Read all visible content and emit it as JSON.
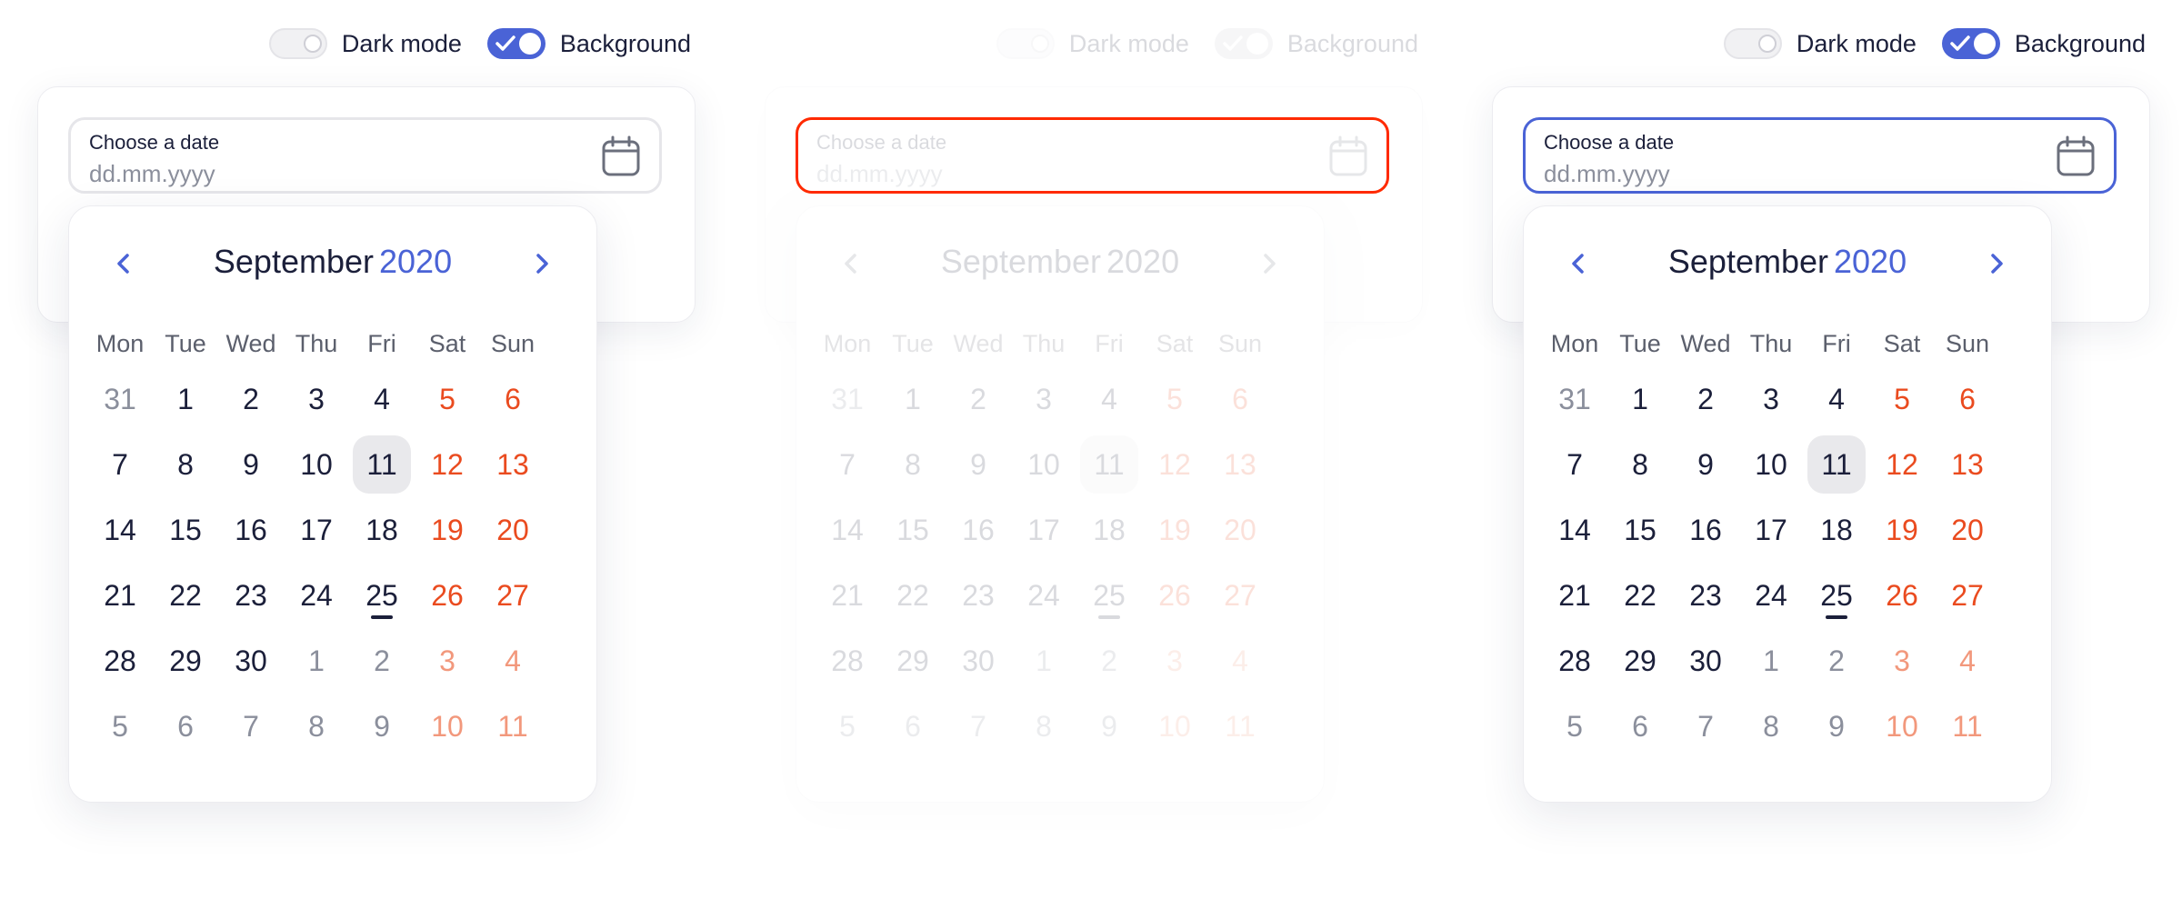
{
  "toggles": {
    "dark_mode_label": "Dark mode",
    "background_label": "Background"
  },
  "date_field": {
    "label": "Choose a date",
    "placeholder": "dd.mm.yyyy"
  },
  "calendar": {
    "month": "September",
    "year": "2020",
    "weekdays": [
      "Mon",
      "Tue",
      "Wed",
      "Thu",
      "Fri",
      "Sat",
      "Sun"
    ],
    "weeks": [
      [
        "31",
        "1",
        "2",
        "3",
        "4",
        "5",
        "6"
      ],
      [
        "7",
        "8",
        "9",
        "10",
        "11",
        "12",
        "13"
      ],
      [
        "14",
        "15",
        "16",
        "17",
        "18",
        "19",
        "20"
      ],
      [
        "21",
        "22",
        "23",
        "24",
        "25",
        "26",
        "27"
      ],
      [
        "28",
        "29",
        "30",
        "1",
        "2",
        "3",
        "4"
      ],
      [
        "5",
        "6",
        "7",
        "8",
        "9",
        "10",
        "11"
      ]
    ],
    "selected_day": "11",
    "underlined_day": "25"
  },
  "colors": {
    "accent": "#4a63d6",
    "weekend": "#ea4b1f",
    "error_border": "#ff2a00"
  },
  "icons": {
    "calendar": "calendar-icon",
    "prev": "chevron-left-icon",
    "next": "chevron-right-icon",
    "check": "check-icon"
  }
}
